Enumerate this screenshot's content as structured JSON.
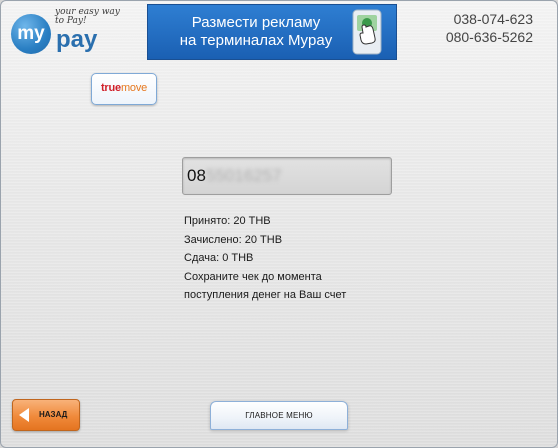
{
  "header": {
    "logo": {
      "word_my": "my",
      "word_pay": "pay",
      "tagline": "your easy way to Pay!"
    },
    "banner": {
      "line1": "Размести рекламу",
      "line2": "на терминалах Mypay"
    },
    "phones": [
      "038-074-623",
      "080-636-5262"
    ]
  },
  "operator": {
    "name_part1": "true",
    "name_part2": "move"
  },
  "phone_field": {
    "prefix": "08",
    "masked": "55016257"
  },
  "receipt": {
    "accepted": "Принято: 20 THB",
    "credited": "Зачислено: 20 THB",
    "change": "Сдача: 0 THB",
    "note_line1": "Сохраните чек до момента",
    "note_line2": "поступления денег на Ваш счет"
  },
  "buttons": {
    "back": "НАЗАД",
    "main_menu": "ГЛАВНОЕ МЕНЮ"
  }
}
